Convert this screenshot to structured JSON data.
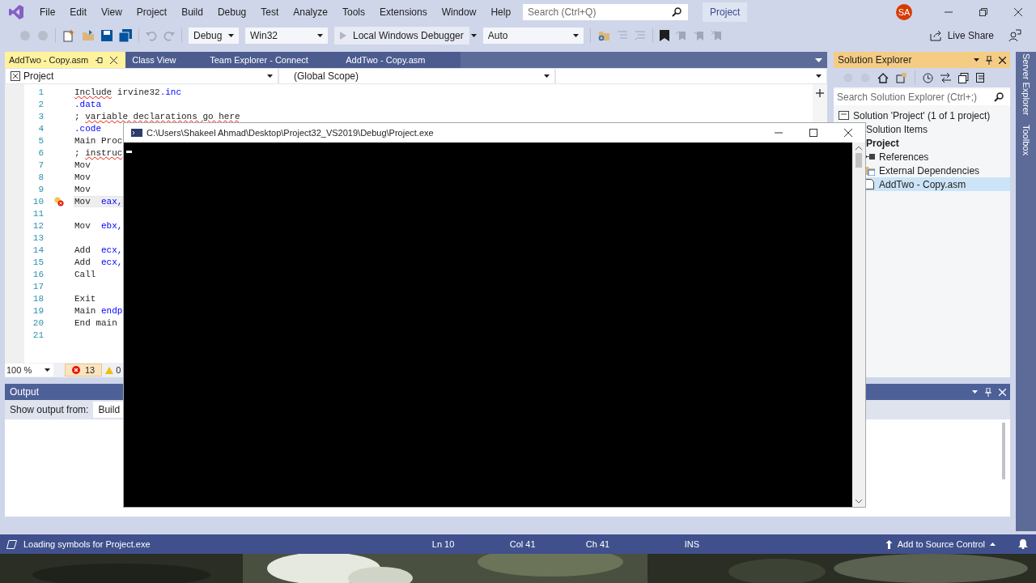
{
  "menu": {
    "items": [
      "File",
      "Edit",
      "View",
      "Project",
      "Build",
      "Debug",
      "Test",
      "Analyze",
      "Tools",
      "Extensions",
      "Window",
      "Help"
    ]
  },
  "search": {
    "placeholder": "Search (Ctrl+Q)"
  },
  "solution_badge": "Project",
  "avatar": {
    "initials": "SA"
  },
  "toolbar": {
    "configuration": "Debug",
    "platform": "Win32",
    "debugger": "Local Windows Debugger",
    "mode": "Auto",
    "live_share": "Live Share"
  },
  "doc_tabs": [
    {
      "label": "AddTwo - Copy.asm",
      "selected": true
    },
    {
      "label": "Class View",
      "selected": false
    },
    {
      "label": "Team Explorer - Connect",
      "selected": false
    },
    {
      "label": "AddTwo - Copy.asm",
      "selected": false
    }
  ],
  "nav_bar": {
    "project": "Project",
    "scope": "(Global Scope)"
  },
  "editor": {
    "lines": [
      {
        "number": "1",
        "current": false,
        "segments": [
          {
            "text": "Include",
            "kind": "error"
          },
          {
            "text": " irvine32",
            "kind": "plain"
          },
          {
            "text": ".inc",
            "kind": "keyword"
          }
        ]
      },
      {
        "number": "2",
        "current": false,
        "segments": [
          {
            "text": ".data",
            "kind": "keyword"
          }
        ]
      },
      {
        "number": "3",
        "current": false,
        "segments": [
          {
            "text": "; ",
            "kind": "plain"
          },
          {
            "text": "variable declarations go here",
            "kind": "error"
          }
        ]
      },
      {
        "number": "4",
        "current": false,
        "segments": [
          {
            "text": ".code",
            "kind": "keyword"
          }
        ]
      },
      {
        "number": "5",
        "current": false,
        "segments": [
          {
            "text": "Main Proc",
            "kind": "plain"
          }
        ]
      },
      {
        "number": "6",
        "current": false,
        "segments": [
          {
            "text": "; ",
            "kind": "plain"
          },
          {
            "text": "instruc",
            "kind": "error"
          }
        ]
      },
      {
        "number": "7",
        "current": false,
        "segments": [
          {
            "text": "Mov",
            "kind": "plain"
          }
        ]
      },
      {
        "number": "8",
        "current": false,
        "segments": [
          {
            "text": "Mov",
            "kind": "plain"
          }
        ]
      },
      {
        "number": "9",
        "current": false,
        "segments": [
          {
            "text": "Mov",
            "kind": "plain"
          }
        ]
      },
      {
        "number": "10",
        "current": true,
        "segments": [
          {
            "text": "Mov  ",
            "kind": "plain"
          },
          {
            "text": "eax,",
            "kind": "keyword"
          }
        ]
      },
      {
        "number": "11",
        "current": false
      },
      {
        "number": "12",
        "current": false,
        "segments": [
          {
            "text": "Mov  ",
            "kind": "plain"
          },
          {
            "text": "ebx,",
            "kind": "keyword"
          }
        ]
      },
      {
        "number": "13",
        "current": false
      },
      {
        "number": "14",
        "current": false,
        "segments": [
          {
            "text": "Add  ",
            "kind": "plain"
          },
          {
            "text": "ecx,",
            "kind": "keyword"
          }
        ]
      },
      {
        "number": "15",
        "current": false,
        "segments": [
          {
            "text": "Add  ",
            "kind": "plain"
          },
          {
            "text": "ecx,",
            "kind": "keyword"
          }
        ]
      },
      {
        "number": "16",
        "current": false,
        "segments": [
          {
            "text": "Call",
            "kind": "plain"
          }
        ]
      },
      {
        "number": "17",
        "current": false
      },
      {
        "number": "18",
        "current": false,
        "segments": [
          {
            "text": "Exit",
            "kind": "plain"
          }
        ]
      },
      {
        "number": "19",
        "current": false,
        "segments": [
          {
            "text": "Main ",
            "kind": "plain"
          },
          {
            "text": "endp",
            "kind": "keyword"
          }
        ]
      },
      {
        "number": "20",
        "current": false,
        "segments": [
          {
            "text": "End main",
            "kind": "plain"
          }
        ]
      },
      {
        "number": "21",
        "current": false
      }
    ],
    "zoom": "100 %",
    "errors": "13",
    "warnings": "0"
  },
  "output": {
    "title": "Output",
    "label": "Show output from:",
    "source": "Build"
  },
  "solution_explorer": {
    "title": "Solution Explorer",
    "search_placeholder": "Search Solution Explorer (Ctrl+;)",
    "tree": [
      {
        "label": "Solution 'Project' (1 of 1 project)",
        "kind": "solution",
        "selected": false,
        "children": [
          {
            "label": "Solution Items",
            "kind": "folder",
            "selected": false
          },
          {
            "label": "Project",
            "kind": "project",
            "selected": false,
            "children": [
              {
                "label": "References",
                "kind": "references",
                "selected": false
              },
              {
                "label": "External Dependencies",
                "kind": "dependencies",
                "selected": false
              },
              {
                "label": "AddTwo - Copy.asm",
                "kind": "file",
                "selected": true
              }
            ]
          }
        ]
      }
    ]
  },
  "side_tabs": [
    "Server Explorer",
    "Toolbox"
  ],
  "status_bar": {
    "message": "Loading symbols for Project.exe",
    "line": "Ln 10",
    "column": "Col 41",
    "char": "Ch 41",
    "mode": "INS",
    "source_control": "Add to Source Control"
  },
  "console": {
    "title": "C:\\Users\\Shakeel Ahmad\\Desktop\\Project32_VS2019\\Debug\\Project.exe"
  },
  "wallpaper": {
    "kind": "picture"
  }
}
